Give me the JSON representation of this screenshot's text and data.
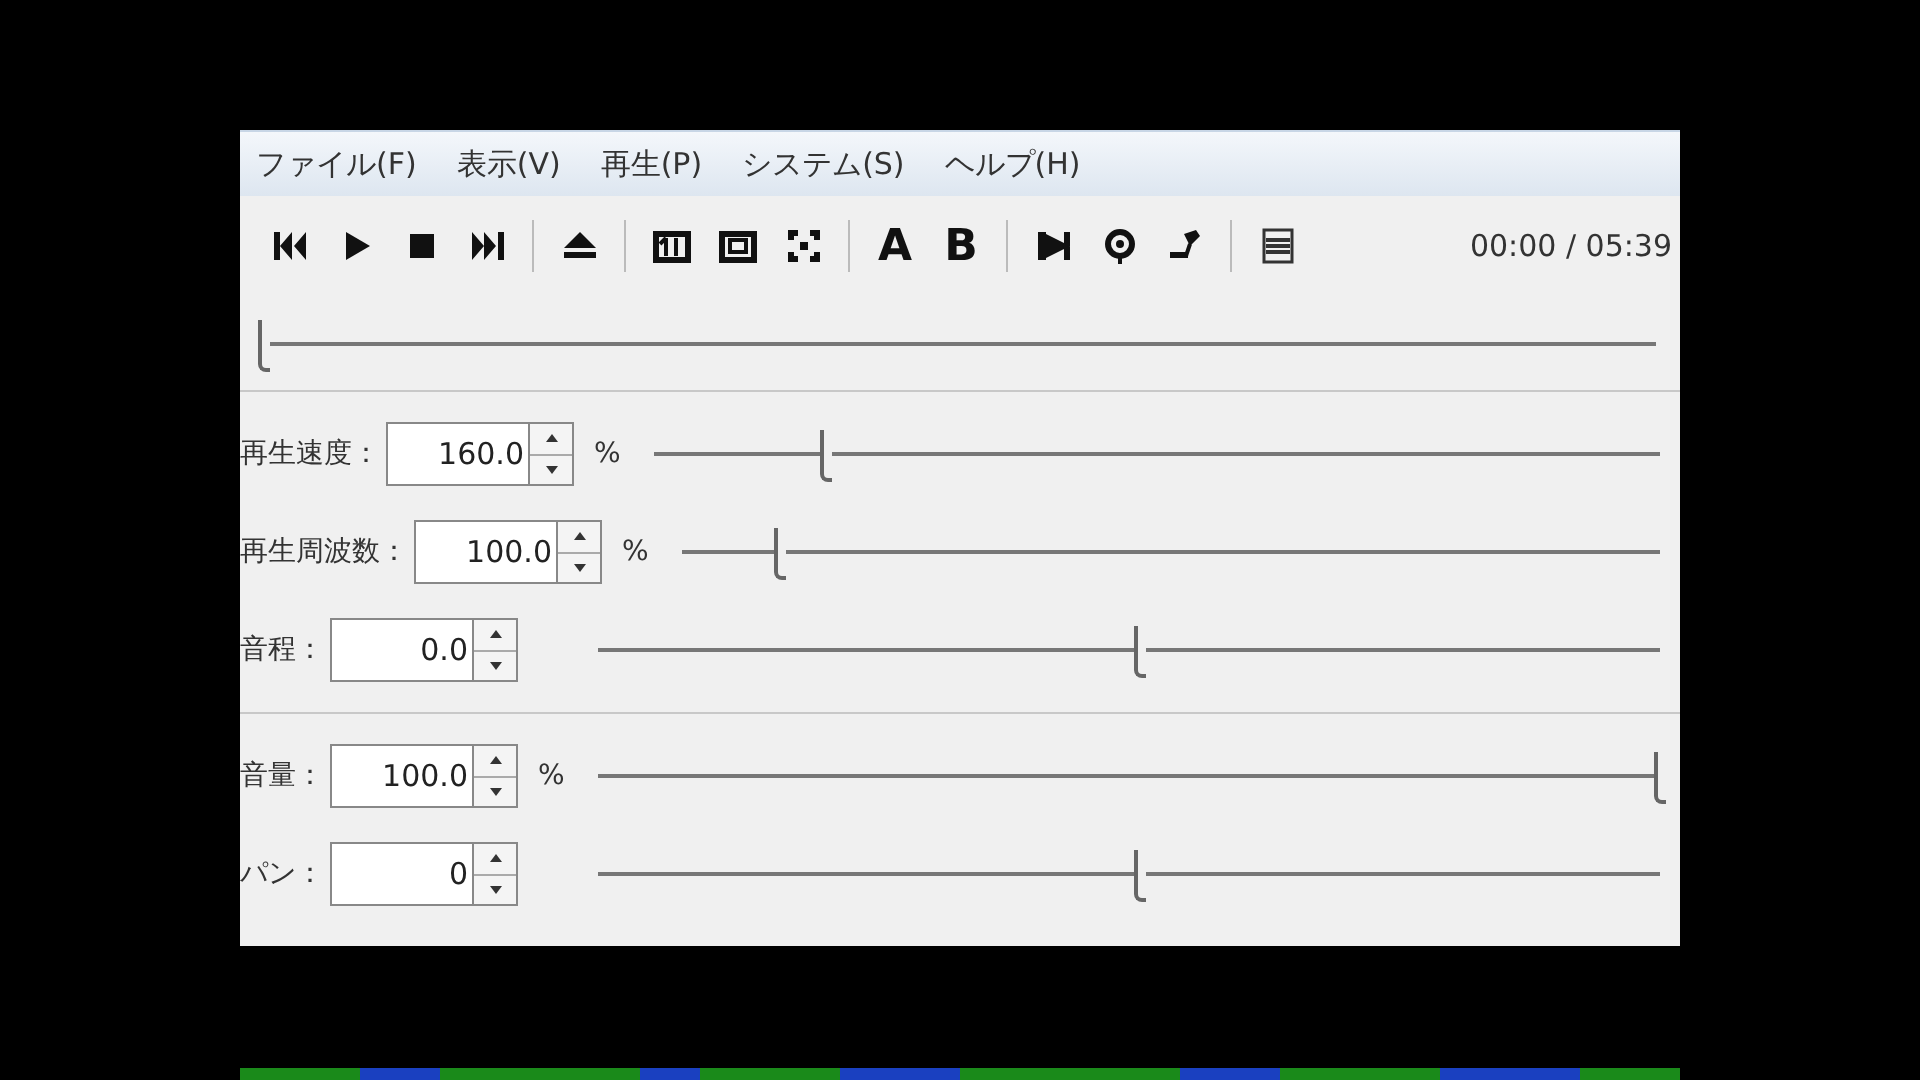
{
  "menu": [
    "ファイル(F)",
    "表示(V)",
    "再生(P)",
    "システム(S)",
    "ヘルプ(H)"
  ],
  "toolbar": {
    "ab_labels": [
      "A",
      "B"
    ],
    "time": "00:00 / 05:39"
  },
  "seek": {
    "level": 0
  },
  "groups": [
    [
      {
        "label": "再生速度：",
        "value": "160.0",
        "unit": "%",
        "level": 0.17
      },
      {
        "label": "再生周波数：",
        "value": "100.0",
        "unit": "%",
        "level": 0.1
      },
      {
        "label": "音程：",
        "value": "0.0",
        "level": 0.51
      }
    ],
    [
      {
        "label": "音量：",
        "value": "100.0",
        "unit": "%",
        "level": 1
      },
      {
        "label": "パン：",
        "value": "0",
        "level": 0.51
      }
    ]
  ]
}
